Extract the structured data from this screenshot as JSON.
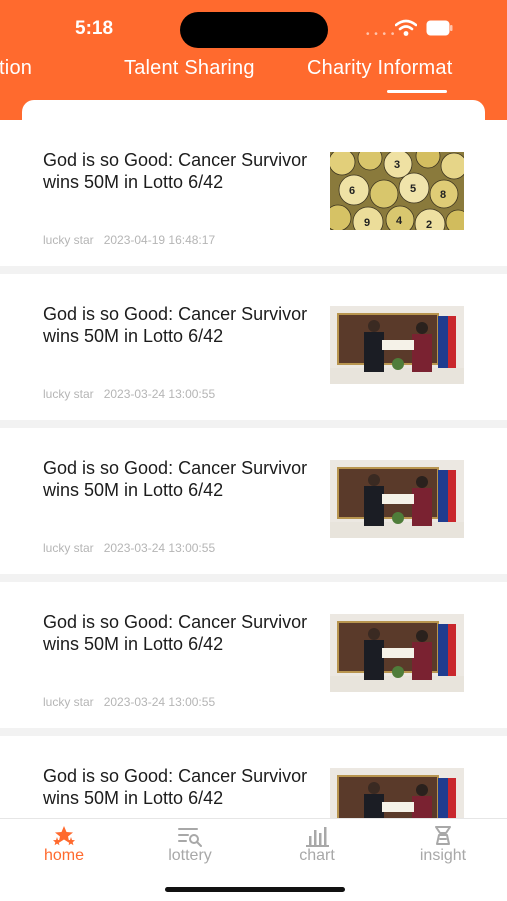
{
  "status_bar": {
    "time": "5:18"
  },
  "tabs": [
    {
      "label": "rmation"
    },
    {
      "label": "Talent Sharing"
    },
    {
      "label": "Charity Informat"
    }
  ],
  "articles": [
    {
      "title": "God is so Good: Cancer Survivor wins 50M in Lotto 6/42",
      "author": "lucky star",
      "date": "2023-04-19 16:48:17",
      "image": "lottery-balls"
    },
    {
      "title": "God is so Good: Cancer Survivor wins 50M in Lotto 6/42",
      "author": "lucky star",
      "date": "2023-03-24 13:00:55",
      "image": "winner-check-presentation"
    },
    {
      "title": "God is so Good: Cancer Survivor wins 50M in Lotto 6/42",
      "author": "lucky star",
      "date": "2023-03-24 13:00:55",
      "image": "winner-check-presentation"
    },
    {
      "title": "God is so Good: Cancer Survivor wins 50M in Lotto 6/42",
      "author": "lucky star",
      "date": "2023-03-24 13:00:55",
      "image": "winner-check-presentation"
    },
    {
      "title": "God is so Good: Cancer Survivor wins 50M in Lotto 6/42",
      "author": "",
      "date": "",
      "image": "winner-check-presentation"
    }
  ],
  "tabbar": [
    {
      "label": "home",
      "icon": "home-stars-icon",
      "active": true
    },
    {
      "label": "lottery",
      "icon": "lottery-search-icon",
      "active": false
    },
    {
      "label": "chart",
      "icon": "bar-chart-icon",
      "active": false
    },
    {
      "label": "insight",
      "icon": "insight-icon",
      "active": false
    }
  ],
  "colors": {
    "accent": "#ff6a2e",
    "text": "#1c1c1c",
    "meta": "#b5b5b5",
    "inactive": "#a8a8a8"
  }
}
